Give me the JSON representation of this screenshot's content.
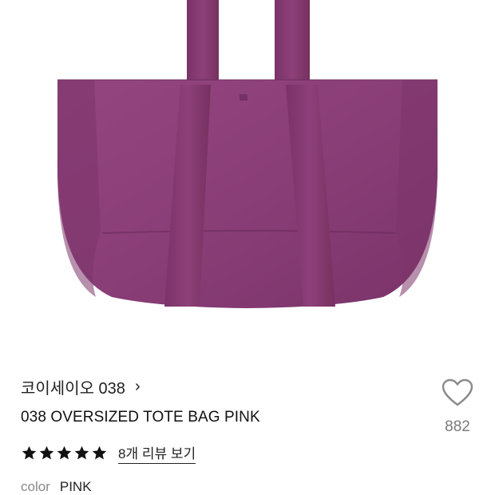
{
  "product": {
    "brand": "코이세이오 038",
    "brand_chevron": "›",
    "title": "038 OVERSIZED TOTE BAG PINK",
    "rating_stars": 5,
    "review_link": "8개 리뷰 보기",
    "color_label": "color",
    "color_value": "PINK",
    "wishlist_count": "882"
  },
  "colors": {
    "bag_main": "#8a3f78",
    "bag_dark": "#6e2e60",
    "star": "#111111",
    "heart_outline": "#8a8a8a"
  },
  "icons": {
    "brand_chevron": "chevron-right-icon",
    "star": "star-icon",
    "wishlist": "heart-outline-icon"
  }
}
